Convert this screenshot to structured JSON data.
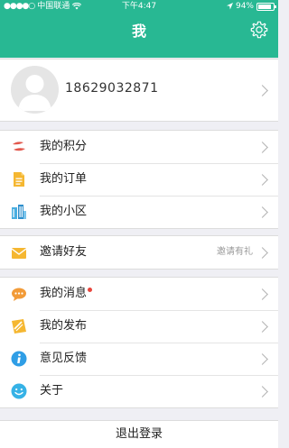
{
  "status_bar": {
    "carrier": "中国联通",
    "time": "下午4:47",
    "battery": "94%"
  },
  "header": {
    "title": "我",
    "settings_icon": "gear-icon"
  },
  "profile": {
    "phone": "18629032871"
  },
  "menu": {
    "group1": [
      {
        "label": "我的积分",
        "icon": "points-icon"
      },
      {
        "label": "我的订单",
        "icon": "orders-icon"
      },
      {
        "label": "我的小区",
        "icon": "community-icon"
      }
    ],
    "invite": {
      "label": "邀请好友",
      "extra": "邀请有礼",
      "icon": "invite-icon"
    },
    "group3": [
      {
        "label": "我的消息",
        "icon": "message-icon"
      },
      {
        "label": "我的发布",
        "icon": "publish-icon"
      },
      {
        "label": "意见反馈",
        "icon": "feedback-icon"
      },
      {
        "label": "关于",
        "icon": "about-icon"
      }
    ]
  },
  "logout_label": "退出登录",
  "colors": {
    "header": "#28b893",
    "background": "#efeff4",
    "badge": "#e8453c"
  }
}
